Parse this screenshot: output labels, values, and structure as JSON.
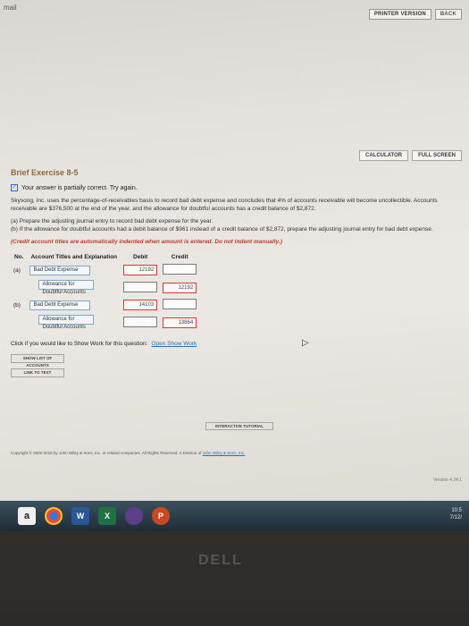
{
  "screen": {
    "top_label": "mail",
    "nav_buttons": [
      "PRINTER VERSION",
      "BACK"
    ],
    "toolbar": [
      "CALCULATOR",
      "FULL SCREEN"
    ]
  },
  "exercise": {
    "title": "Brief Exercise 8-5",
    "status": "Your answer is partially correct.  Try again.",
    "problem": "Skysong, Inc. uses the percentage-of-receivables basis to record bad debt expense and concludes that 4% of accounts receivable will become uncollectible. Accounts receivable are $376,500 at the end of the year, and the allowance for doubtful accounts has a credit balance of $2,872.",
    "part_a": "(a)   Prepare the adjusting journal entry to record bad debt expense for the year.",
    "part_b": "(b)   If the allowance for doubtful accounts had a debit balance of $961 instead of a credit balance of $2,872, prepare the adjusting journal entry for bad debt expense.",
    "instructions": "(Credit account titles are automatically indented when amount is entered. Do not indent manually.)"
  },
  "journal": {
    "headers": {
      "no": "No.",
      "account": "Account Titles and Explanation",
      "debit": "Debit",
      "credit": "Credit"
    },
    "rows": [
      {
        "no": "(a)",
        "account": "Bad Debt Expense",
        "debit": "12192",
        "credit": "",
        "indent": false,
        "debit_state": "wrong",
        "credit_state": "ok"
      },
      {
        "no": "",
        "account": "Allowance for Doubtful Accounts",
        "debit": "",
        "credit": "12192",
        "indent": true,
        "debit_state": "ok",
        "credit_state": "wrong"
      },
      {
        "no": "(b)",
        "account": "Bad Debt Expense",
        "debit": "14103",
        "credit": "",
        "indent": false,
        "debit_state": "wrong",
        "credit_state": "ok"
      },
      {
        "no": "",
        "account": "Allowance for Doubtful Accounts",
        "debit": "",
        "credit": "13864",
        "indent": true,
        "debit_state": "ok",
        "credit_state": "wrong"
      }
    ]
  },
  "show_work": {
    "question": "Click if you would like to Show Work for this question:",
    "link": "Open Show Work"
  },
  "buttons": {
    "chart": "SHOW LIST OF ACCOUNTS",
    "link": "LINK TO TEXT",
    "tutorial": "INTERACTIVE TUTORIAL"
  },
  "footer": {
    "links": "Copyright © 2000-2015 by John Wiley & Sons, Inc. or related companies. All Rights Reserved. A Division of",
    "company": "John Wiley & Sons, Inc."
  },
  "version": "Version 4.24.1",
  "taskbar": {
    "icons": [
      "a",
      "W",
      "X",
      "P"
    ]
  },
  "tray": {
    "time": "10:5",
    "date": "7/12/"
  },
  "brand": "DELL"
}
